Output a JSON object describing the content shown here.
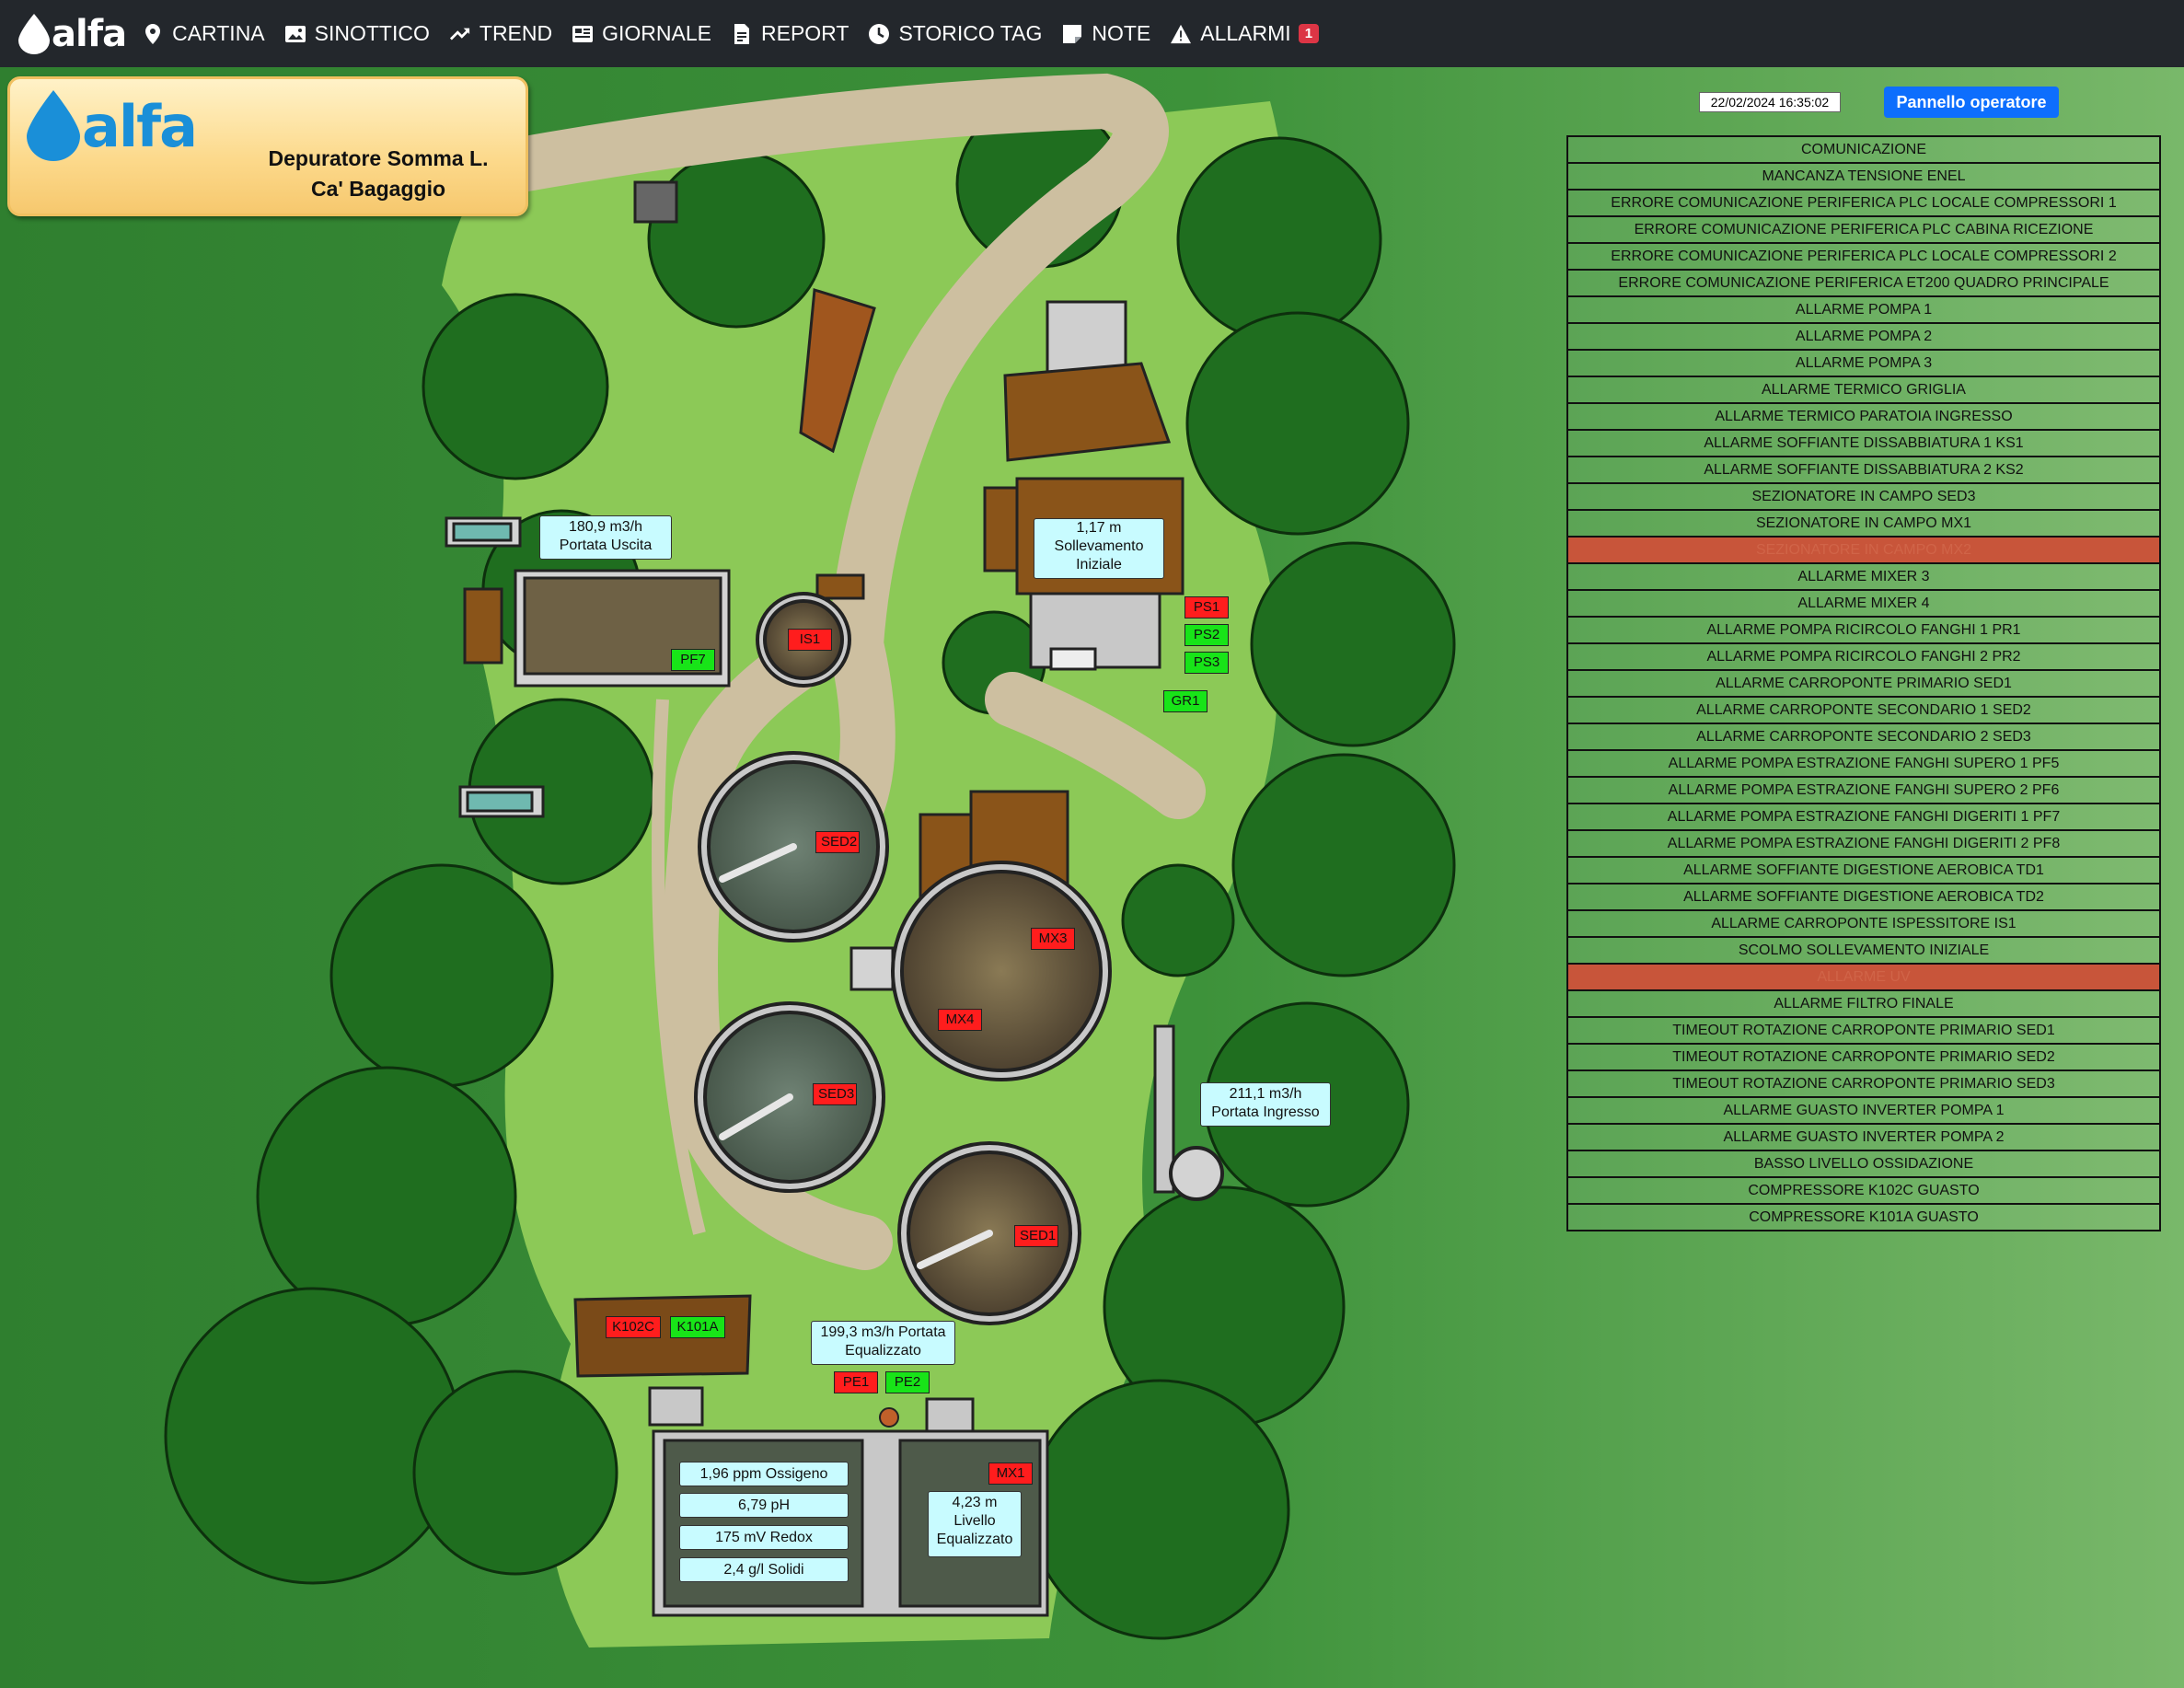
{
  "nav": {
    "brand": "alfa",
    "items": [
      {
        "label": "CARTINA",
        "icon": "map-pin-icon"
      },
      {
        "label": "SINOTTICO",
        "icon": "image-icon"
      },
      {
        "label": "TREND",
        "icon": "trend-icon"
      },
      {
        "label": "GIORNALE",
        "icon": "newspaper-icon"
      },
      {
        "label": "REPORT",
        "icon": "report-icon"
      },
      {
        "label": "STORICO TAG",
        "icon": "clock-icon"
      },
      {
        "label": "NOTE",
        "icon": "note-icon"
      },
      {
        "label": "ALLARMI",
        "icon": "warning-icon"
      }
    ],
    "alarm_count": "1"
  },
  "plant": {
    "logo": "alfa",
    "name_line1": "Depuratore Somma L.",
    "name_line2": "Ca' Bagaggio"
  },
  "timestamp": "22/02/2024 16:35:02",
  "operator_button": "Pannello operatore",
  "alarms": [
    {
      "label": "COMUNICAZIONE",
      "active": false
    },
    {
      "label": "MANCANZA TENSIONE ENEL",
      "active": false
    },
    {
      "label": "ERRORE COMUNICAZIONE PERIFERICA PLC LOCALE COMPRESSORI 1",
      "active": false
    },
    {
      "label": "ERRORE COMUNICAZIONE PERIFERICA PLC CABINA RICEZIONE",
      "active": false
    },
    {
      "label": "ERRORE COMUNICAZIONE PERIFERICA PLC LOCALE COMPRESSORI 2",
      "active": false
    },
    {
      "label": "ERRORE COMUNICAZIONE PERIFERICA ET200 QUADRO PRINCIPALE",
      "active": false
    },
    {
      "label": "ALLARME POMPA 1",
      "active": false
    },
    {
      "label": "ALLARME POMPA 2",
      "active": false
    },
    {
      "label": "ALLARME POMPA 3",
      "active": false
    },
    {
      "label": "ALLARME TERMICO GRIGLIA",
      "active": false
    },
    {
      "label": "ALLARME TERMICO PARATOIA INGRESSO",
      "active": false
    },
    {
      "label": "ALLARME SOFFIANTE DISSABBIATURA 1 KS1",
      "active": false
    },
    {
      "label": "ALLARME SOFFIANTE DISSABBIATURA 2 KS2",
      "active": false
    },
    {
      "label": "SEZIONATORE IN CAMPO SED3",
      "active": false
    },
    {
      "label": "SEZIONATORE IN CAMPO MX1",
      "active": false
    },
    {
      "label": "SEZIONATORE IN CAMPO MX2",
      "active": true
    },
    {
      "label": "ALLARME MIXER 3",
      "active": false
    },
    {
      "label": "ALLARME MIXER 4",
      "active": false
    },
    {
      "label": "ALLARME POMPA RICIRCOLO FANGHI 1 PR1",
      "active": false
    },
    {
      "label": "ALLARME POMPA RICIRCOLO FANGHI 2 PR2",
      "active": false
    },
    {
      "label": "ALLARME CARROPONTE PRIMARIO SED1",
      "active": false
    },
    {
      "label": "ALLARME CARROPONTE SECONDARIO 1 SED2",
      "active": false
    },
    {
      "label": "ALLARME CARROPONTE SECONDARIO 2 SED3",
      "active": false
    },
    {
      "label": "ALLARME POMPA ESTRAZIONE FANGHI SUPERO 1 PF5",
      "active": false
    },
    {
      "label": "ALLARME POMPA ESTRAZIONE FANGHI SUPERO 2 PF6",
      "active": false
    },
    {
      "label": "ALLARME POMPA ESTRAZIONE FANGHI DIGERITI 1 PF7",
      "active": false
    },
    {
      "label": "ALLARME POMPA ESTRAZIONE FANGHI DIGERITI 2 PF8",
      "active": false
    },
    {
      "label": "ALLARME SOFFIANTE DIGESTIONE AEROBICA TD1",
      "active": false
    },
    {
      "label": "ALLARME SOFFIANTE DIGESTIONE AEROBICA TD2",
      "active": false
    },
    {
      "label": "ALLARME CARROPONTE ISPESSITORE IS1",
      "active": false
    },
    {
      "label": "SCOLMO SOLLEVAMENTO INIZIALE",
      "active": false
    },
    {
      "label": "ALLARME UV",
      "active": true
    },
    {
      "label": "ALLARME FILTRO FINALE",
      "active": false
    },
    {
      "label": "TIMEOUT ROTAZIONE CARROPONTE PRIMARIO SED1",
      "active": false
    },
    {
      "label": "TIMEOUT ROTAZIONE CARROPONTE PRIMARIO SED2",
      "active": false
    },
    {
      "label": "TIMEOUT ROTAZIONE CARROPONTE PRIMARIO SED3",
      "active": false
    },
    {
      "label": "ALLARME GUASTO INVERTER POMPA 1",
      "active": false
    },
    {
      "label": "ALLARME GUASTO INVERTER POMPA 2",
      "active": false
    },
    {
      "label": "BASSO LIVELLO OSSIDAZIONE",
      "active": false
    },
    {
      "label": "COMPRESSORE K102C GUASTO",
      "active": false
    },
    {
      "label": "COMPRESSORE K101A GUASTO",
      "active": false
    }
  ],
  "tags": {
    "ps1": {
      "label": "PS1",
      "state": "alarm"
    },
    "ps2": {
      "label": "PS2",
      "state": "ok"
    },
    "ps3": {
      "label": "PS3",
      "state": "ok"
    },
    "gr1": {
      "label": "GR1",
      "state": "ok"
    },
    "is1": {
      "label": "IS1",
      "state": "alarm"
    },
    "pf7": {
      "label": "PF7",
      "state": "ok"
    },
    "sed2": {
      "label": "SED2",
      "state": "alarm"
    },
    "sed3": {
      "label": "SED3",
      "state": "alarm"
    },
    "sed1": {
      "label": "SED1",
      "state": "alarm"
    },
    "mx3": {
      "label": "MX3",
      "state": "alarm"
    },
    "mx4": {
      "label": "MX4",
      "state": "alarm"
    },
    "mx1": {
      "label": "MX1",
      "state": "alarm"
    },
    "k102c": {
      "label": "K102C",
      "state": "alarm"
    },
    "k101a": {
      "label": "K101A",
      "state": "ok"
    },
    "pe1": {
      "label": "PE1",
      "state": "alarm"
    },
    "pe2": {
      "label": "PE2",
      "state": "ok"
    }
  },
  "readings": {
    "portata_uscita": {
      "value": "180,9 m3/h",
      "label": "Portata Uscita"
    },
    "sollevamento": {
      "value": "1,17 m",
      "label1": "Sollevamento",
      "label2": "Iniziale"
    },
    "portata_ingresso": {
      "value": "211,1 m3/h",
      "label": "Portata Ingresso"
    },
    "portata_equalizzato": {
      "line1": "199,3 m3/h Portata",
      "line2": "Equalizzato"
    },
    "livello_eq": {
      "value": "4,23 m",
      "label1": "Livello",
      "label2": "Equalizzato"
    },
    "ossigeno": "1,96 ppm Ossigeno",
    "ph": "6,79 pH",
    "redox": "175 mV Redox",
    "solidi": "2,4 g/l Solidi"
  },
  "colors": {
    "alarm_red": "#ff1d1d",
    "ok_green": "#18e418",
    "active_row": "#c8553a",
    "nav_bg": "#23272c",
    "primary_blue": "#0d6efd",
    "info_bg": "#c8fbff"
  }
}
